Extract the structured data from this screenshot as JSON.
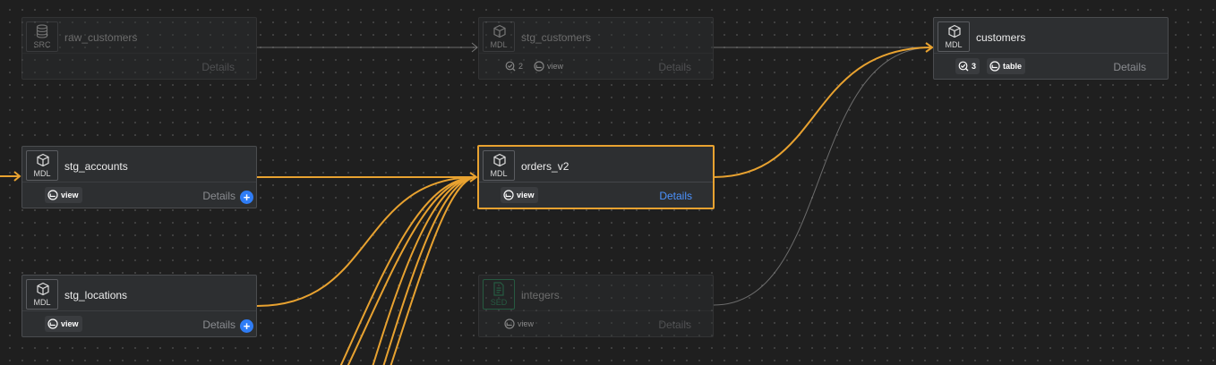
{
  "colors": {
    "canvas": "#1f1f1f",
    "node": "#2d2f31",
    "selected_border": "#e8a230",
    "lineage_edge": "#e8a230",
    "dim_edge": "#8c8c8c",
    "details_active": "#4c93ff",
    "plus_button": "#2f7df6",
    "seed_green": "#2fa36b"
  },
  "nodes": {
    "raw_customers": {
      "type": "SRC",
      "name": "raw_customers",
      "details": "Details",
      "icon": "database-icon"
    },
    "stg_customers": {
      "type": "MDL",
      "name": "stg_customers",
      "test_count": "2",
      "materialization": "view",
      "details": "Details",
      "icon": "cube-icon"
    },
    "customers": {
      "type": "MDL",
      "name": "customers",
      "test_count": "3",
      "materialization": "table",
      "details": "Details",
      "icon": "cube-icon"
    },
    "stg_accounts": {
      "type": "MDL",
      "name": "stg_accounts",
      "materialization": "view",
      "details": "Details",
      "icon": "cube-icon"
    },
    "orders_v2": {
      "type": "MDL",
      "name": "orders_v2",
      "materialization": "view",
      "details": "Details",
      "icon": "cube-icon"
    },
    "stg_locations": {
      "type": "MDL",
      "name": "stg_locations",
      "materialization": "view",
      "details": "Details",
      "icon": "cube-icon"
    },
    "integers": {
      "type": "SED",
      "name": "integers",
      "materialization": "view",
      "details": "Details",
      "icon": "seed-file-icon"
    }
  }
}
